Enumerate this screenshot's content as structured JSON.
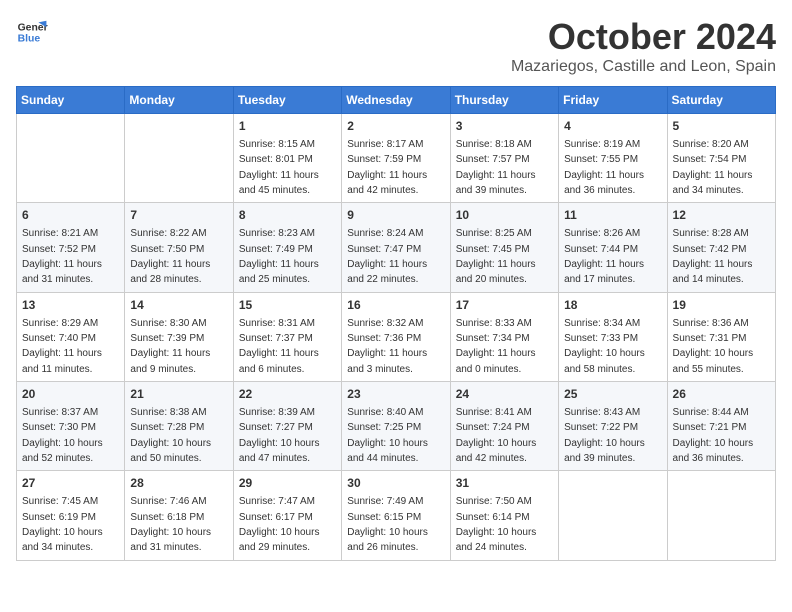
{
  "logo": {
    "line1": "General",
    "line2": "Blue"
  },
  "title": "October 2024",
  "location": "Mazariegos, Castille and Leon, Spain",
  "days_header": [
    "Sunday",
    "Monday",
    "Tuesday",
    "Wednesday",
    "Thursday",
    "Friday",
    "Saturday"
  ],
  "weeks": [
    [
      {
        "day": "",
        "sunrise": "",
        "sunset": "",
        "daylight": ""
      },
      {
        "day": "",
        "sunrise": "",
        "sunset": "",
        "daylight": ""
      },
      {
        "day": "1",
        "sunrise": "Sunrise: 8:15 AM",
        "sunset": "Sunset: 8:01 PM",
        "daylight": "Daylight: 11 hours and 45 minutes."
      },
      {
        "day": "2",
        "sunrise": "Sunrise: 8:17 AM",
        "sunset": "Sunset: 7:59 PM",
        "daylight": "Daylight: 11 hours and 42 minutes."
      },
      {
        "day": "3",
        "sunrise": "Sunrise: 8:18 AM",
        "sunset": "Sunset: 7:57 PM",
        "daylight": "Daylight: 11 hours and 39 minutes."
      },
      {
        "day": "4",
        "sunrise": "Sunrise: 8:19 AM",
        "sunset": "Sunset: 7:55 PM",
        "daylight": "Daylight: 11 hours and 36 minutes."
      },
      {
        "day": "5",
        "sunrise": "Sunrise: 8:20 AM",
        "sunset": "Sunset: 7:54 PM",
        "daylight": "Daylight: 11 hours and 34 minutes."
      }
    ],
    [
      {
        "day": "6",
        "sunrise": "Sunrise: 8:21 AM",
        "sunset": "Sunset: 7:52 PM",
        "daylight": "Daylight: 11 hours and 31 minutes."
      },
      {
        "day": "7",
        "sunrise": "Sunrise: 8:22 AM",
        "sunset": "Sunset: 7:50 PM",
        "daylight": "Daylight: 11 hours and 28 minutes."
      },
      {
        "day": "8",
        "sunrise": "Sunrise: 8:23 AM",
        "sunset": "Sunset: 7:49 PM",
        "daylight": "Daylight: 11 hours and 25 minutes."
      },
      {
        "day": "9",
        "sunrise": "Sunrise: 8:24 AM",
        "sunset": "Sunset: 7:47 PM",
        "daylight": "Daylight: 11 hours and 22 minutes."
      },
      {
        "day": "10",
        "sunrise": "Sunrise: 8:25 AM",
        "sunset": "Sunset: 7:45 PM",
        "daylight": "Daylight: 11 hours and 20 minutes."
      },
      {
        "day": "11",
        "sunrise": "Sunrise: 8:26 AM",
        "sunset": "Sunset: 7:44 PM",
        "daylight": "Daylight: 11 hours and 17 minutes."
      },
      {
        "day": "12",
        "sunrise": "Sunrise: 8:28 AM",
        "sunset": "Sunset: 7:42 PM",
        "daylight": "Daylight: 11 hours and 14 minutes."
      }
    ],
    [
      {
        "day": "13",
        "sunrise": "Sunrise: 8:29 AM",
        "sunset": "Sunset: 7:40 PM",
        "daylight": "Daylight: 11 hours and 11 minutes."
      },
      {
        "day": "14",
        "sunrise": "Sunrise: 8:30 AM",
        "sunset": "Sunset: 7:39 PM",
        "daylight": "Daylight: 11 hours and 9 minutes."
      },
      {
        "day": "15",
        "sunrise": "Sunrise: 8:31 AM",
        "sunset": "Sunset: 7:37 PM",
        "daylight": "Daylight: 11 hours and 6 minutes."
      },
      {
        "day": "16",
        "sunrise": "Sunrise: 8:32 AM",
        "sunset": "Sunset: 7:36 PM",
        "daylight": "Daylight: 11 hours and 3 minutes."
      },
      {
        "day": "17",
        "sunrise": "Sunrise: 8:33 AM",
        "sunset": "Sunset: 7:34 PM",
        "daylight": "Daylight: 11 hours and 0 minutes."
      },
      {
        "day": "18",
        "sunrise": "Sunrise: 8:34 AM",
        "sunset": "Sunset: 7:33 PM",
        "daylight": "Daylight: 10 hours and 58 minutes."
      },
      {
        "day": "19",
        "sunrise": "Sunrise: 8:36 AM",
        "sunset": "Sunset: 7:31 PM",
        "daylight": "Daylight: 10 hours and 55 minutes."
      }
    ],
    [
      {
        "day": "20",
        "sunrise": "Sunrise: 8:37 AM",
        "sunset": "Sunset: 7:30 PM",
        "daylight": "Daylight: 10 hours and 52 minutes."
      },
      {
        "day": "21",
        "sunrise": "Sunrise: 8:38 AM",
        "sunset": "Sunset: 7:28 PM",
        "daylight": "Daylight: 10 hours and 50 minutes."
      },
      {
        "day": "22",
        "sunrise": "Sunrise: 8:39 AM",
        "sunset": "Sunset: 7:27 PM",
        "daylight": "Daylight: 10 hours and 47 minutes."
      },
      {
        "day": "23",
        "sunrise": "Sunrise: 8:40 AM",
        "sunset": "Sunset: 7:25 PM",
        "daylight": "Daylight: 10 hours and 44 minutes."
      },
      {
        "day": "24",
        "sunrise": "Sunrise: 8:41 AM",
        "sunset": "Sunset: 7:24 PM",
        "daylight": "Daylight: 10 hours and 42 minutes."
      },
      {
        "day": "25",
        "sunrise": "Sunrise: 8:43 AM",
        "sunset": "Sunset: 7:22 PM",
        "daylight": "Daylight: 10 hours and 39 minutes."
      },
      {
        "day": "26",
        "sunrise": "Sunrise: 8:44 AM",
        "sunset": "Sunset: 7:21 PM",
        "daylight": "Daylight: 10 hours and 36 minutes."
      }
    ],
    [
      {
        "day": "27",
        "sunrise": "Sunrise: 7:45 AM",
        "sunset": "Sunset: 6:19 PM",
        "daylight": "Daylight: 10 hours and 34 minutes."
      },
      {
        "day": "28",
        "sunrise": "Sunrise: 7:46 AM",
        "sunset": "Sunset: 6:18 PM",
        "daylight": "Daylight: 10 hours and 31 minutes."
      },
      {
        "day": "29",
        "sunrise": "Sunrise: 7:47 AM",
        "sunset": "Sunset: 6:17 PM",
        "daylight": "Daylight: 10 hours and 29 minutes."
      },
      {
        "day": "30",
        "sunrise": "Sunrise: 7:49 AM",
        "sunset": "Sunset: 6:15 PM",
        "daylight": "Daylight: 10 hours and 26 minutes."
      },
      {
        "day": "31",
        "sunrise": "Sunrise: 7:50 AM",
        "sunset": "Sunset: 6:14 PM",
        "daylight": "Daylight: 10 hours and 24 minutes."
      },
      {
        "day": "",
        "sunrise": "",
        "sunset": "",
        "daylight": ""
      },
      {
        "day": "",
        "sunrise": "",
        "sunset": "",
        "daylight": ""
      }
    ]
  ]
}
